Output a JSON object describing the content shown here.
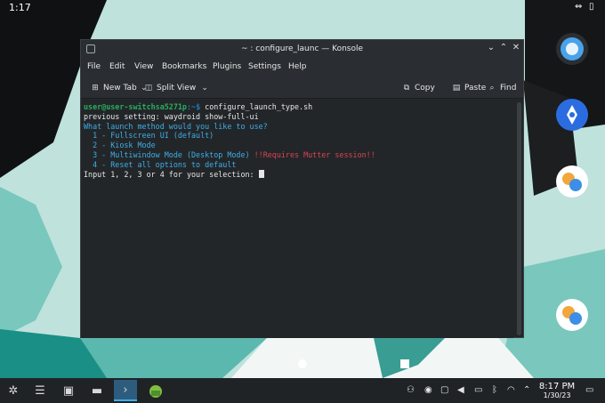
{
  "status_bar": {
    "time": "1:17",
    "icons": [
      "swap-icon",
      "battery-icon"
    ]
  },
  "window": {
    "title": "~ : configure_launc — Konsole",
    "menu": [
      "File",
      "Edit",
      "View",
      "Bookmarks",
      "Plugins",
      "Settings",
      "Help"
    ],
    "toolbar": {
      "new_tab": "New Tab",
      "split_view": "Split View",
      "copy": "Copy",
      "paste": "Paste",
      "find": "Find"
    }
  },
  "terminal": {
    "prompt_user": "user@user-switchsa5271p",
    "prompt_path": ":~$",
    "command": " configure_launch_type.sh",
    "line_prev": "previous setting: waydroid show-full-ui",
    "question": "What launch method would you like to use?",
    "opt1": "  1 - Fullscreen UI (default)",
    "opt2": "  2 - Kiosk Mode",
    "opt3": "  3 - Multiwindow Mode (Desktop Mode) ",
    "opt3_warn": "!!Requires Mutter session!!",
    "opt4": "  4 - Reset all options to default",
    "input_prompt": "Input 1, 2, 3 or 4 for your selection: "
  },
  "taskbar": {
    "apps": [
      "app-launcher-icon",
      "settings-icon",
      "store-icon",
      "file-manager-icon",
      "konsole-icon",
      "waydroid-icon"
    ],
    "clock_time": "8:17 PM",
    "clock_date": "1/30/23"
  },
  "colors": {
    "terminal_bg": "#232629",
    "prompt_green": "#27ae60",
    "accent_blue": "#1d99f3",
    "warning_red": "#da4453"
  }
}
